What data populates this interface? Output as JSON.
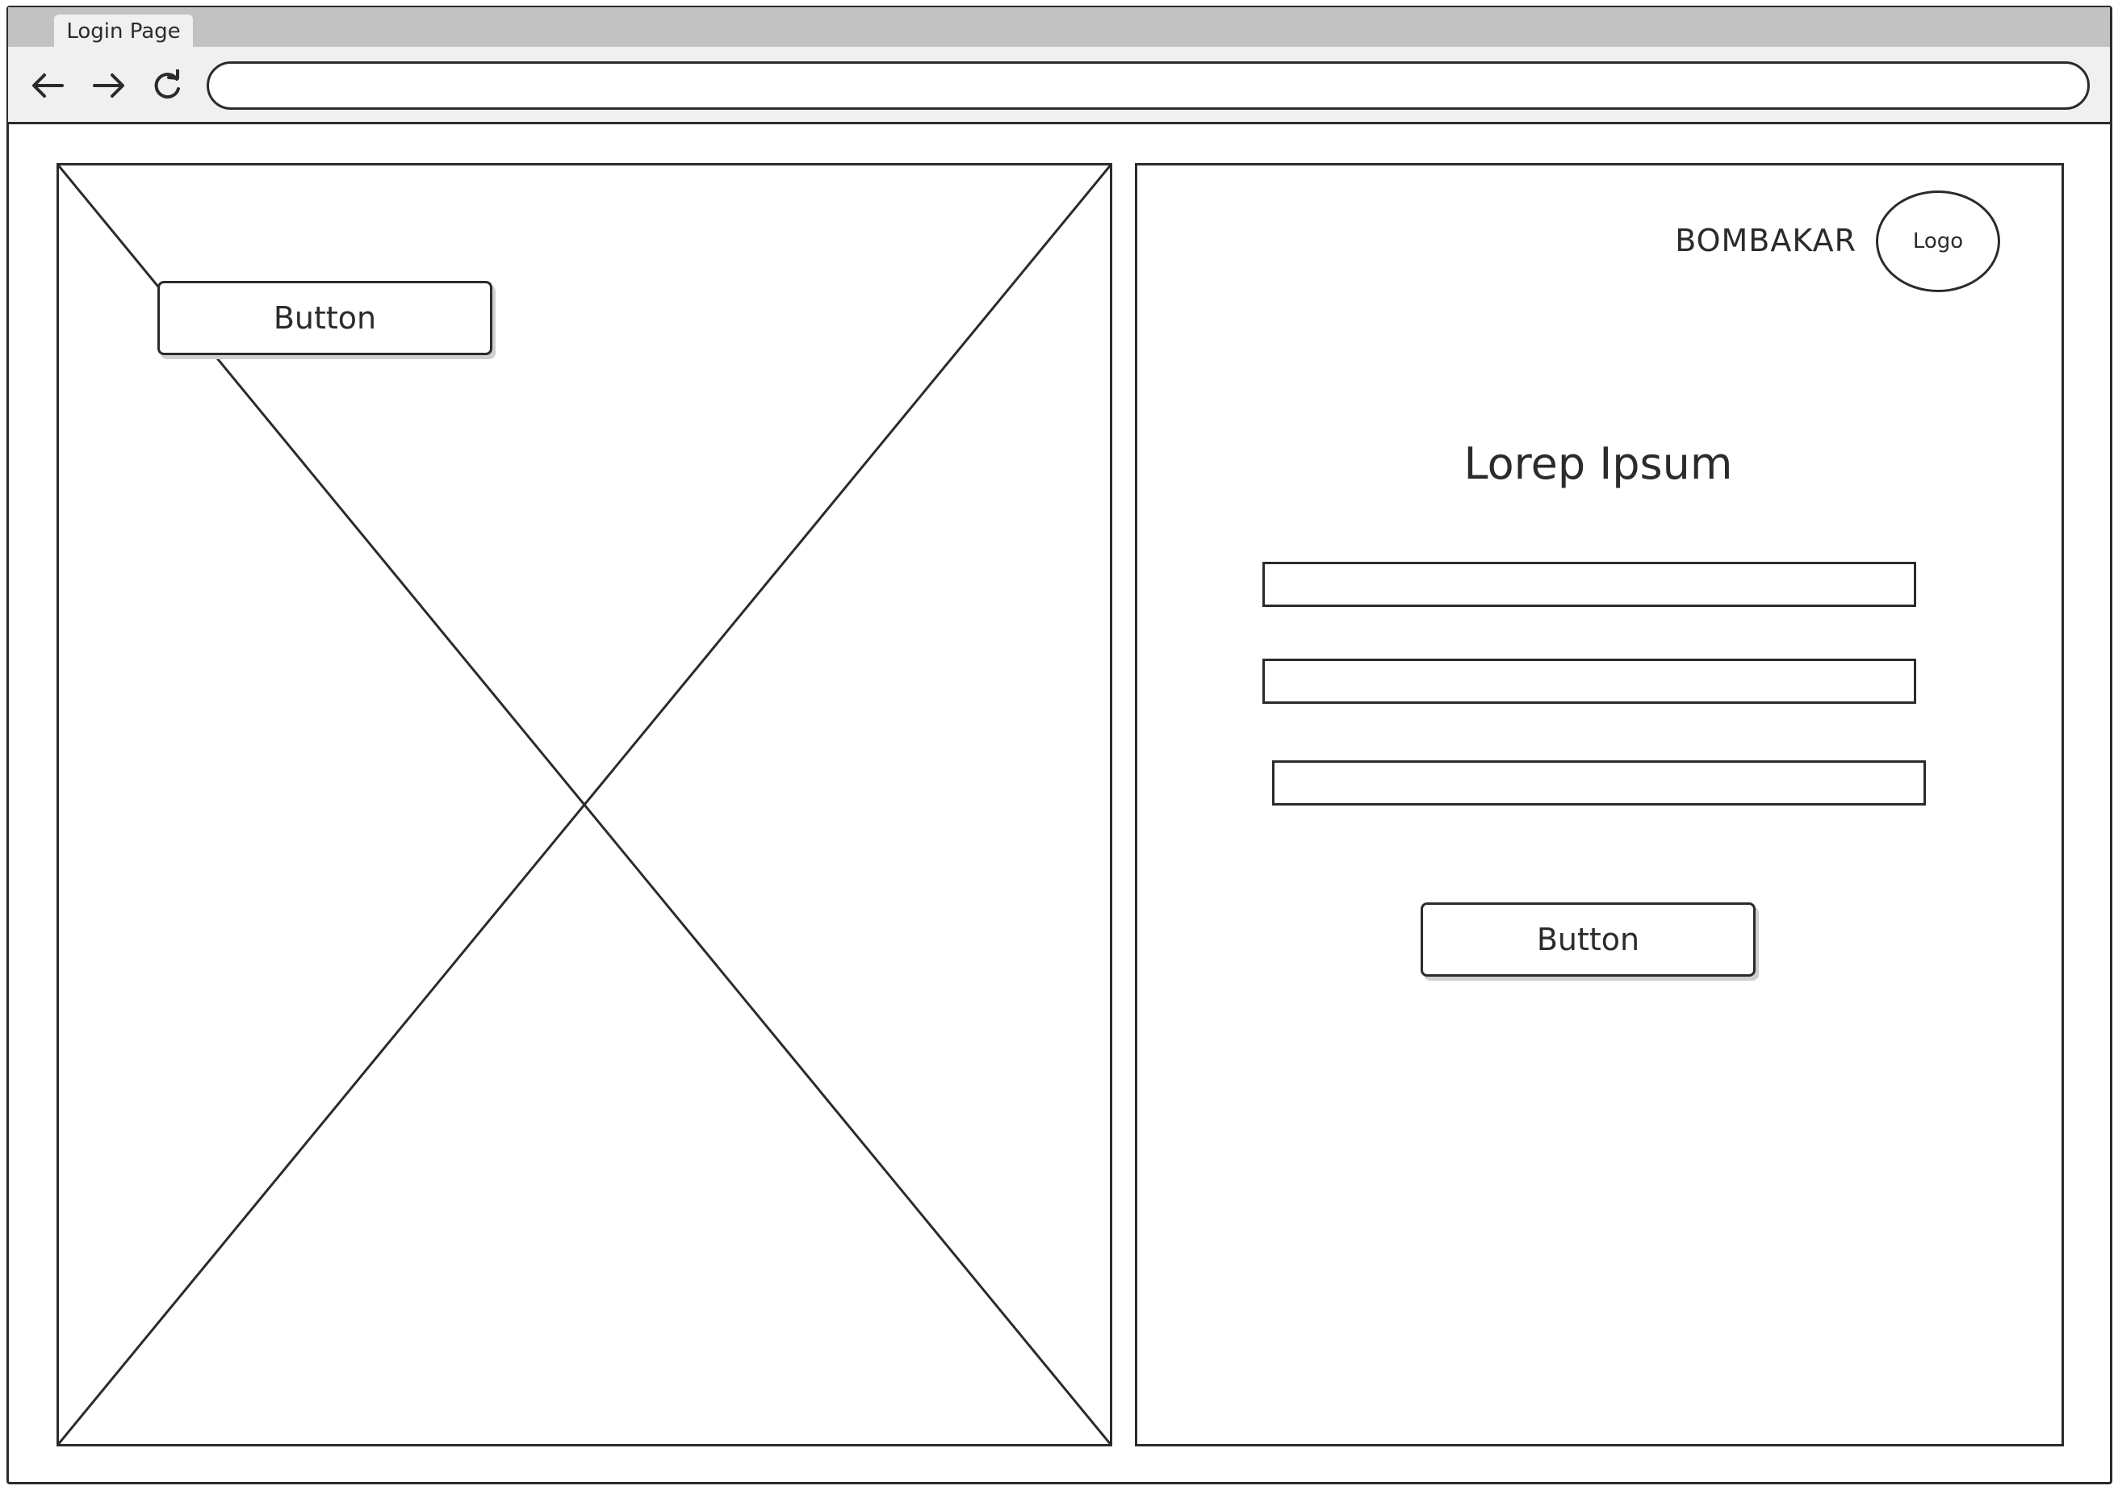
{
  "browser": {
    "tab_title": "Login Page",
    "nav": {
      "back_icon": "arrow-left-icon",
      "forward_icon": "arrow-right-icon",
      "reload_icon": "reload-icon"
    },
    "address_bar": {
      "value": ""
    }
  },
  "image_panel": {
    "type": "image-placeholder",
    "button_label": "Button"
  },
  "login_panel": {
    "brand_name": "BOMBAKAR",
    "logo_label": "Logo",
    "heading": "Lorep Ipsum",
    "fields": [
      "",
      "",
      ""
    ],
    "submit_label": "Button"
  },
  "colors": {
    "stroke": "#2b2b2b",
    "tabstrip": "#c2c2c2",
    "toolbar": "#f0f0f0",
    "background": "#ffffff"
  }
}
